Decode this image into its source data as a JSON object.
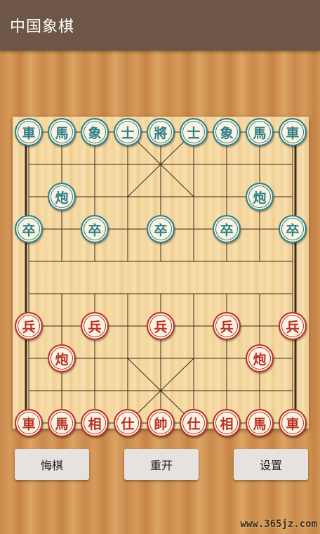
{
  "app": {
    "title": "中国象棋"
  },
  "board": {
    "black_pieces": [
      {
        "label": "車",
        "col": 0,
        "row": 0
      },
      {
        "label": "馬",
        "col": 1,
        "row": 0
      },
      {
        "label": "象",
        "col": 2,
        "row": 0
      },
      {
        "label": "士",
        "col": 3,
        "row": 0
      },
      {
        "label": "將",
        "col": 4,
        "row": 0
      },
      {
        "label": "士",
        "col": 5,
        "row": 0
      },
      {
        "label": "象",
        "col": 6,
        "row": 0
      },
      {
        "label": "馬",
        "col": 7,
        "row": 0
      },
      {
        "label": "車",
        "col": 8,
        "row": 0
      },
      {
        "label": "炮",
        "col": 1,
        "row": 2
      },
      {
        "label": "炮",
        "col": 7,
        "row": 2
      },
      {
        "label": "卒",
        "col": 0,
        "row": 3
      },
      {
        "label": "卒",
        "col": 2,
        "row": 3
      },
      {
        "label": "卒",
        "col": 4,
        "row": 3
      },
      {
        "label": "卒",
        "col": 6,
        "row": 3
      },
      {
        "label": "卒",
        "col": 8,
        "row": 3
      }
    ],
    "red_pieces": [
      {
        "label": "兵",
        "col": 0,
        "row": 6
      },
      {
        "label": "兵",
        "col": 2,
        "row": 6
      },
      {
        "label": "兵",
        "col": 4,
        "row": 6
      },
      {
        "label": "兵",
        "col": 6,
        "row": 6
      },
      {
        "label": "兵",
        "col": 8,
        "row": 6
      },
      {
        "label": "炮",
        "col": 1,
        "row": 7
      },
      {
        "label": "炮",
        "col": 7,
        "row": 7
      },
      {
        "label": "車",
        "col": 0,
        "row": 9
      },
      {
        "label": "馬",
        "col": 1,
        "row": 9
      },
      {
        "label": "相",
        "col": 2,
        "row": 9
      },
      {
        "label": "仕",
        "col": 3,
        "row": 9
      },
      {
        "label": "帥",
        "col": 4,
        "row": 9
      },
      {
        "label": "仕",
        "col": 5,
        "row": 9
      },
      {
        "label": "相",
        "col": 6,
        "row": 9
      },
      {
        "label": "馬",
        "col": 7,
        "row": 9
      },
      {
        "label": "車",
        "col": 8,
        "row": 9
      }
    ]
  },
  "controls": {
    "undo_label": "悔棋",
    "restart_label": "重开",
    "settings_label": "设置"
  },
  "watermark": "www.365jz.com",
  "colors": {
    "black_side": "#2e7f86",
    "red_side": "#b8322a",
    "titlebar": "#6d5646"
  }
}
